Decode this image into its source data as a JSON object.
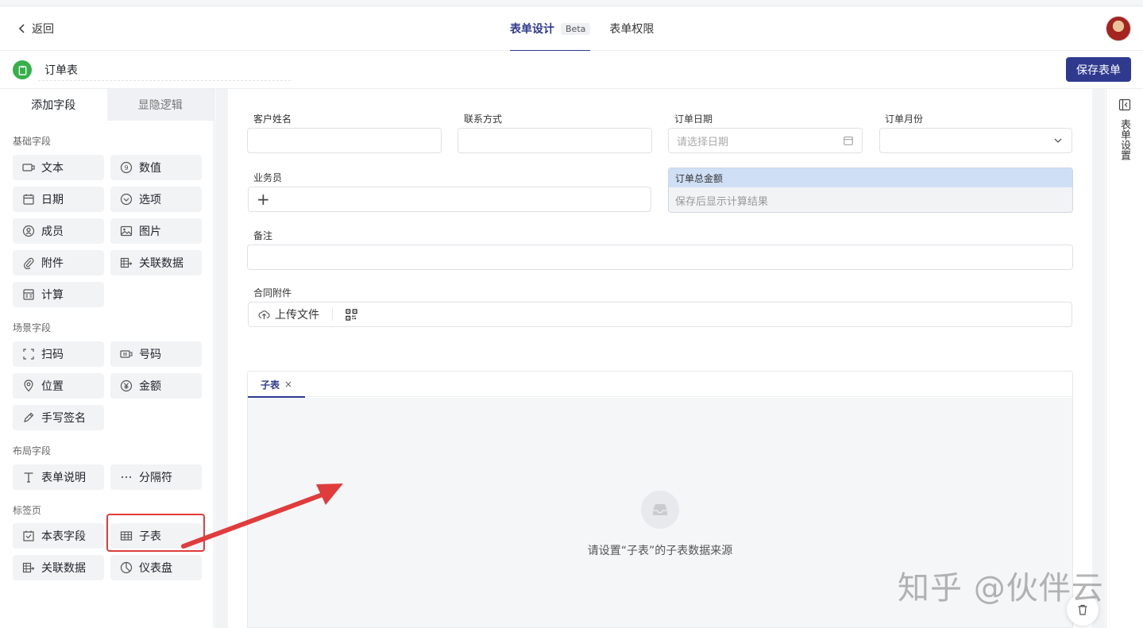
{
  "nav": {
    "back_label": "返回",
    "tabs": [
      {
        "label": "表单设计",
        "badge": "Beta",
        "active": true
      },
      {
        "label": "表单权限",
        "active": false
      }
    ]
  },
  "titlebar": {
    "form_name": "订单表",
    "save_label": "保存表单"
  },
  "leftpanel": {
    "tabs": [
      "添加字段",
      "显隐逻辑"
    ],
    "groups": [
      {
        "title": "基础字段",
        "items": [
          {
            "label": "文本",
            "icon": "text-field-icon"
          },
          {
            "label": "数值",
            "icon": "number-icon"
          },
          {
            "label": "日期",
            "icon": "calendar-icon"
          },
          {
            "label": "选项",
            "icon": "option-icon"
          },
          {
            "label": "成员",
            "icon": "member-icon"
          },
          {
            "label": "图片",
            "icon": "image-icon"
          },
          {
            "label": "附件",
            "icon": "paperclip-icon"
          },
          {
            "label": "关联数据",
            "icon": "relation-icon"
          },
          {
            "label": "计算",
            "icon": "calculator-icon"
          }
        ]
      },
      {
        "title": "场景字段",
        "items": [
          {
            "label": "扫码",
            "icon": "scan-icon"
          },
          {
            "label": "号码",
            "icon": "serial-number-icon"
          },
          {
            "label": "位置",
            "icon": "location-icon"
          },
          {
            "label": "金额",
            "icon": "yen-icon"
          },
          {
            "label": "手写签名",
            "icon": "signature-icon"
          }
        ]
      },
      {
        "title": "布局字段",
        "items": [
          {
            "label": "表单说明",
            "icon": "text-t-icon"
          },
          {
            "label": "分隔符",
            "icon": "ellipsis-icon"
          }
        ]
      },
      {
        "title": "标签页",
        "items": [
          {
            "label": "本表字段",
            "icon": "form-fields-icon"
          },
          {
            "label": "子表",
            "icon": "table-icon"
          },
          {
            "label": "关联数据",
            "icon": "relation-icon"
          },
          {
            "label": "仪表盘",
            "icon": "dashboard-icon"
          }
        ]
      }
    ]
  },
  "form": {
    "fields": {
      "customer_name": {
        "label": "客户姓名",
        "value": ""
      },
      "contact": {
        "label": "联系方式",
        "value": ""
      },
      "order_date": {
        "label": "订单日期",
        "placeholder": "请选择日期"
      },
      "order_month": {
        "label": "订单月份",
        "value": ""
      },
      "salesperson": {
        "label": "业务员",
        "add_symbol": "+"
      },
      "order_total": {
        "label": "订单总金额",
        "hint": "保存后显示计算结果"
      },
      "remarks": {
        "label": "备注",
        "value": ""
      },
      "contract_attachment": {
        "label": "合同附件",
        "upload_label": "上传文件"
      }
    },
    "subtable": {
      "tab_label": "子表",
      "close_symbol": "×",
      "empty_text": "请设置“子表”的子表数据来源"
    }
  },
  "rightrail": {
    "label": "表单设置"
  },
  "watermark": "知乎 @伙伴云",
  "colors": {
    "accent": "#2f3a8f",
    "highlight": "#e03c3c",
    "form_icon": "#36b04a"
  }
}
